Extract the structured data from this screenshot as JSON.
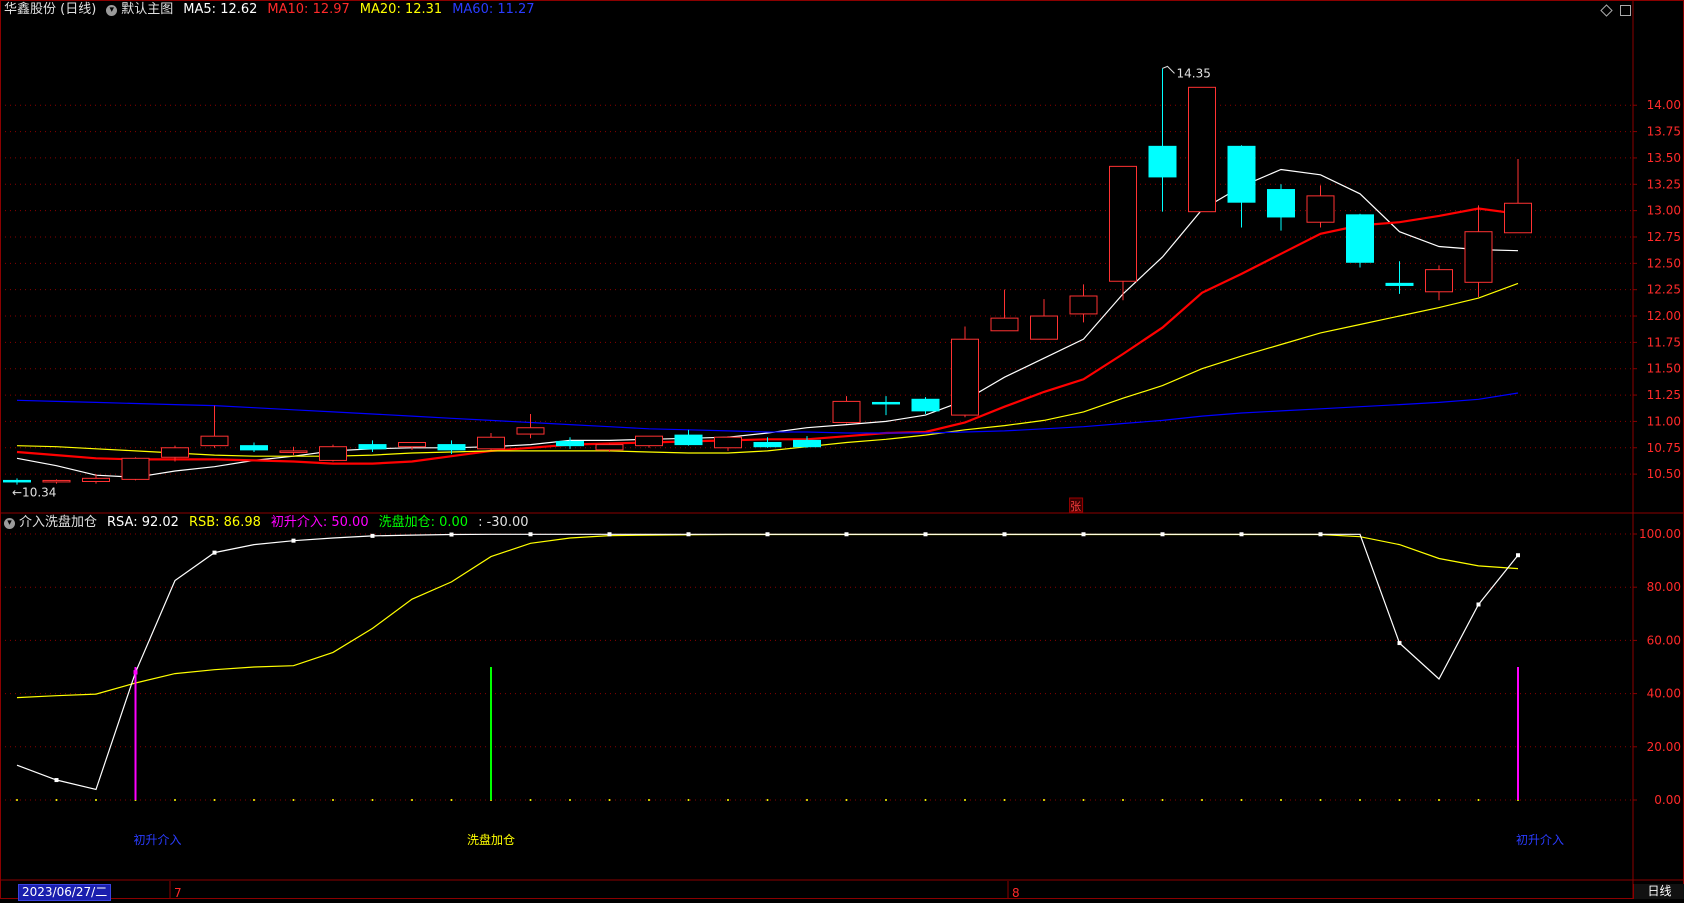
{
  "header": {
    "stock_label": "华鑫股份 (日线)",
    "main_chart_label": "默认主图",
    "ma5": "MA5: 12.62",
    "ma10": "MA10: 12.97",
    "ma20": "MA20: 12.31",
    "ma60": "MA60: 11.27"
  },
  "sub_header": {
    "indicator_label": "介入洗盘加仓",
    "rsa": "RSA: 92.02",
    "rsb": "RSB: 86.98",
    "initial_entry": "初升介入: 50.00",
    "wash_add": "洗盘加仓: 0.00",
    "extra": ": -30.00"
  },
  "footer": {
    "date": "2023/06/27/二",
    "month_7": "7",
    "month_8": "8",
    "period_tab": "日线"
  },
  "colors": {
    "up": "#ff3232",
    "down": "#00ffff",
    "ma5": "#ffffff",
    "ma10": "#ff0000",
    "ma20": "#ffff00",
    "ma60": "#0000ff",
    "grid": "#8b0000",
    "entry_signal": "#ff00ff",
    "wash_signal": "#00ff00"
  },
  "chart_data": [
    {
      "type": "candlestick",
      "title": "华鑫股份 (日线)",
      "price_axis": {
        "ticks": [
          "14.00",
          "13.75",
          "13.50",
          "13.25",
          "13.00",
          "12.75",
          "12.50",
          "12.25",
          "12.00",
          "11.75",
          "11.50",
          "11.25",
          "11.00",
          "10.75",
          "10.50"
        ],
        "ylim": [
          10.15,
          14.6
        ]
      },
      "annotations": {
        "high_label": "14.35",
        "low_label": "←10.34",
        "limit_up_badge": "张"
      },
      "candles": [
        {
          "o": 10.44,
          "h": 10.46,
          "l": 10.4,
          "c": 10.43
        },
        {
          "o": 10.43,
          "h": 10.45,
          "l": 10.41,
          "c": 10.44
        },
        {
          "o": 10.43,
          "h": 10.5,
          "l": 10.41,
          "c": 10.46
        },
        {
          "o": 10.45,
          "h": 10.66,
          "l": 10.44,
          "c": 10.65
        },
        {
          "o": 10.66,
          "h": 10.77,
          "l": 10.62,
          "c": 10.75
        },
        {
          "o": 10.77,
          "h": 11.15,
          "l": 10.75,
          "c": 10.86
        },
        {
          "o": 10.77,
          "h": 10.8,
          "l": 10.71,
          "c": 10.73
        },
        {
          "o": 10.72,
          "h": 10.76,
          "l": 10.68,
          "c": 10.72
        },
        {
          "o": 10.63,
          "h": 10.78,
          "l": 10.62,
          "c": 10.76
        },
        {
          "o": 10.78,
          "h": 10.82,
          "l": 10.71,
          "c": 10.74
        },
        {
          "o": 10.76,
          "h": 10.8,
          "l": 10.73,
          "c": 10.8
        },
        {
          "o": 10.78,
          "h": 10.82,
          "l": 10.69,
          "c": 10.73
        },
        {
          "o": 10.74,
          "h": 10.89,
          "l": 10.73,
          "c": 10.85
        },
        {
          "o": 10.88,
          "h": 11.07,
          "l": 10.84,
          "c": 10.94
        },
        {
          "o": 10.81,
          "h": 10.85,
          "l": 10.74,
          "c": 10.77
        },
        {
          "o": 10.73,
          "h": 10.79,
          "l": 10.71,
          "c": 10.78
        },
        {
          "o": 10.77,
          "h": 10.86,
          "l": 10.75,
          "c": 10.86
        },
        {
          "o": 10.87,
          "h": 10.92,
          "l": 10.77,
          "c": 10.78
        },
        {
          "o": 10.75,
          "h": 10.86,
          "l": 10.72,
          "c": 10.85
        },
        {
          "o": 10.8,
          "h": 10.85,
          "l": 10.75,
          "c": 10.76
        },
        {
          "o": 10.82,
          "h": 10.86,
          "l": 10.75,
          "c": 10.76
        },
        {
          "o": 10.99,
          "h": 11.24,
          "l": 10.98,
          "c": 11.19
        },
        {
          "o": 11.18,
          "h": 11.24,
          "l": 11.06,
          "c": 11.17
        },
        {
          "o": 11.21,
          "h": 11.23,
          "l": 11.07,
          "c": 11.1
        },
        {
          "o": 11.06,
          "h": 11.9,
          "l": 11.04,
          "c": 11.78
        },
        {
          "o": 11.86,
          "h": 12.25,
          "l": 11.86,
          "c": 11.98
        },
        {
          "o": 11.78,
          "h": 12.16,
          "l": 11.78,
          "c": 12.0
        },
        {
          "o": 12.02,
          "h": 12.3,
          "l": 11.94,
          "c": 12.19
        },
        {
          "o": 12.33,
          "h": 13.42,
          "l": 12.15,
          "c": 13.42
        },
        {
          "o": 13.61,
          "h": 14.35,
          "l": 12.99,
          "c": 13.32
        },
        {
          "o": 12.99,
          "h": 14.17,
          "l": 12.99,
          "c": 14.17
        },
        {
          "o": 13.61,
          "h": 13.62,
          "l": 12.84,
          "c": 13.08
        },
        {
          "o": 13.2,
          "h": 13.25,
          "l": 12.81,
          "c": 12.94
        },
        {
          "o": 12.89,
          "h": 13.24,
          "l": 12.84,
          "c": 13.14
        },
        {
          "o": 12.96,
          "h": 12.97,
          "l": 12.46,
          "c": 12.51
        },
        {
          "o": 12.31,
          "h": 12.52,
          "l": 12.21,
          "c": 12.29
        },
        {
          "o": 12.23,
          "h": 12.48,
          "l": 12.15,
          "c": 12.44
        },
        {
          "o": 12.32,
          "h": 13.05,
          "l": 12.18,
          "c": 12.8
        },
        {
          "o": 12.79,
          "h": 13.49,
          "l": 12.79,
          "c": 13.07
        }
      ],
      "series": [
        {
          "name": "MA5",
          "values": [
            10.65,
            10.58,
            10.49,
            10.47,
            10.53,
            10.57,
            10.63,
            10.67,
            10.72,
            10.74,
            10.75,
            10.75,
            10.76,
            10.78,
            10.82,
            10.82,
            10.83,
            10.84,
            10.85,
            10.89,
            10.94,
            10.97,
            11.0,
            11.06,
            11.2,
            11.42,
            11.6,
            11.78,
            12.21,
            12.56,
            13.01,
            13.23,
            13.39,
            13.34,
            13.16,
            12.8,
            12.66,
            12.63,
            12.62
          ]
        },
        {
          "name": "MA10",
          "values": [
            10.71,
            10.68,
            10.65,
            10.64,
            10.64,
            10.64,
            10.63,
            10.62,
            10.6,
            10.6,
            10.62,
            10.67,
            10.72,
            10.75,
            10.78,
            10.79,
            10.8,
            10.81,
            10.82,
            10.83,
            10.83,
            10.86,
            10.89,
            10.9,
            10.99,
            11.14,
            11.28,
            11.4,
            11.64,
            11.89,
            12.22,
            12.4,
            12.59,
            12.78,
            12.86,
            12.89,
            12.95,
            13.02,
            12.97
          ]
        },
        {
          "name": "MA20",
          "values": [
            10.77,
            10.76,
            10.74,
            10.72,
            10.7,
            10.68,
            10.67,
            10.67,
            10.67,
            10.68,
            10.7,
            10.71,
            10.72,
            10.72,
            10.72,
            10.72,
            10.71,
            10.7,
            10.7,
            10.72,
            10.76,
            10.8,
            10.83,
            10.87,
            10.92,
            10.96,
            11.01,
            11.09,
            11.22,
            11.34,
            11.5,
            11.62,
            11.73,
            11.84,
            11.92,
            12.0,
            12.08,
            12.17,
            12.31
          ]
        },
        {
          "name": "MA60",
          "values": [
            11.2,
            11.19,
            11.18,
            11.17,
            11.16,
            11.15,
            11.13,
            11.11,
            11.09,
            11.07,
            11.05,
            11.03,
            11.01,
            10.99,
            10.97,
            10.95,
            10.93,
            10.92,
            10.91,
            10.9,
            10.9,
            10.89,
            10.89,
            10.89,
            10.9,
            10.91,
            10.93,
            10.95,
            10.98,
            11.01,
            11.05,
            11.08,
            11.1,
            11.12,
            11.14,
            11.16,
            11.18,
            11.21,
            11.27
          ]
        }
      ]
    },
    {
      "type": "line",
      "title": "介入洗盘加仓",
      "value_axis": {
        "ticks": [
          "100.00",
          "80.00",
          "60.00",
          "40.00",
          "20.00",
          "0.00"
        ],
        "ylim": [
          -1.5,
          103
        ]
      },
      "series": [
        {
          "name": "RSA",
          "values": [
            13.1,
            7.5,
            4.0,
            48.0,
            82.5,
            93.0,
            96.0,
            97.5,
            98.5,
            99.3,
            99.6,
            99.8,
            99.9,
            99.9,
            99.9,
            99.9,
            99.9,
            99.9,
            99.9,
            99.9,
            99.9,
            99.9,
            99.9,
            99.9,
            99.9,
            99.9,
            99.9,
            99.9,
            99.9,
            99.9,
            99.9,
            99.9,
            99.9,
            99.9,
            99.9,
            59.0,
            45.5,
            73.5,
            92.02
          ]
        },
        {
          "name": "RSB",
          "values": [
            38.5,
            39.2,
            39.8,
            44.0,
            47.5,
            49.0,
            50.0,
            50.5,
            55.5,
            64.5,
            75.5,
            82.0,
            91.5,
            96.5,
            98.5,
            99.4,
            99.6,
            99.7,
            99.8,
            99.8,
            99.8,
            99.8,
            99.8,
            99.8,
            99.8,
            99.8,
            99.8,
            99.8,
            99.8,
            99.8,
            99.8,
            99.8,
            99.8,
            99.8,
            99.0,
            96.0,
            90.8,
            88.0,
            86.98
          ]
        }
      ],
      "signals": [
        {
          "index": 3,
          "value": 50,
          "label": "初升介入"
        },
        {
          "index": 12,
          "value": 50,
          "label": "洗盘加仓"
        },
        {
          "index": 38,
          "value": 50,
          "label": "初升介入"
        }
      ]
    }
  ]
}
